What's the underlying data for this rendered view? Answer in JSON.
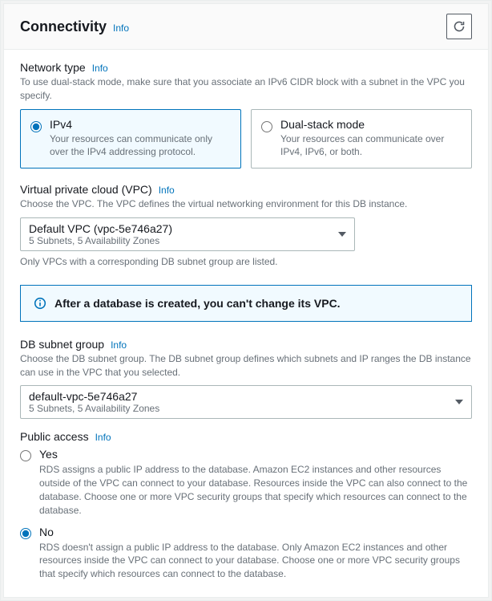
{
  "header": {
    "title": "Connectivity",
    "info": "Info"
  },
  "network_type": {
    "label": "Network type",
    "info": "Info",
    "desc": "To use dual-stack mode, make sure that you associate an IPv6 CIDR block with a subnet in the VPC you specify.",
    "option_ipv4": {
      "title": "IPv4",
      "desc": "Your resources can communicate only over the IPv4 addressing protocol."
    },
    "option_dual": {
      "title": "Dual-stack mode",
      "desc": "Your resources can communicate over IPv4, IPv6, or both."
    }
  },
  "vpc": {
    "label": "Virtual private cloud (VPC)",
    "info": "Info",
    "desc": "Choose the VPC. The VPC defines the virtual networking environment for this DB instance.",
    "selected_main": "Default VPC (vpc-5e746a27)",
    "selected_sub": "5 Subnets, 5 Availability Zones",
    "note": "Only VPCs with a corresponding DB subnet group are listed."
  },
  "banner": {
    "msg": "After a database is created, you can't change its VPC."
  },
  "subnet": {
    "label": "DB subnet group",
    "info": "Info",
    "desc": "Choose the DB subnet group. The DB subnet group defines which subnets and IP ranges the DB instance can use in the VPC that you selected.",
    "selected_main": "default-vpc-5e746a27",
    "selected_sub": "5 Subnets, 5 Availability Zones"
  },
  "public_access": {
    "label": "Public access",
    "info": "Info",
    "yes_label": "Yes",
    "yes_desc": "RDS assigns a public IP address to the database. Amazon EC2 instances and other resources outside of the VPC can connect to your database. Resources inside the VPC can also connect to the database. Choose one or more VPC security groups that specify which resources can connect to the database.",
    "no_label": "No",
    "no_desc": "RDS doesn't assign a public IP address to the database. Only Amazon EC2 instances and other resources inside the VPC can connect to your database. Choose one or more VPC security groups that specify which resources can connect to the database."
  }
}
